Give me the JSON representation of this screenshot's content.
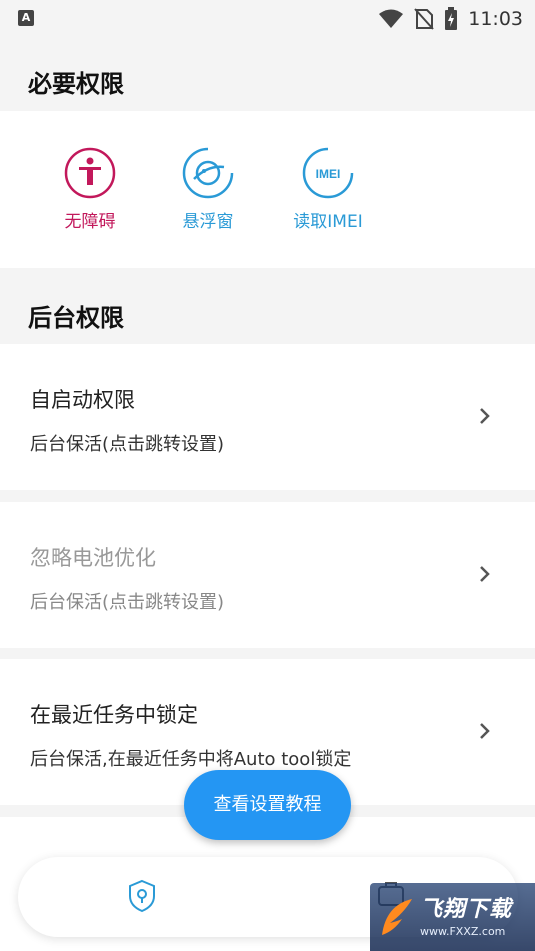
{
  "status_bar": {
    "left_icon_letter": "A",
    "time": "11:03",
    "icons": [
      "wifi-icon",
      "no-sim-icon",
      "battery-charging-icon"
    ]
  },
  "required_permissions": {
    "title": "必要权限",
    "items": [
      {
        "label": "无障碍",
        "icon": "accessibility-icon",
        "color": "#c2185b"
      },
      {
        "label": "悬浮窗",
        "icon": "floating-window-icon",
        "color": "#2a9ad6"
      },
      {
        "label": "读取IMEI",
        "icon": "imei-icon",
        "color": "#2a9ad6",
        "icon_text": "IMEI"
      }
    ]
  },
  "background_permissions": {
    "title": "后台权限",
    "rows": [
      {
        "title": "自启动权限",
        "subtitle": "后台保活(点击跳转设置)",
        "dimmed": false
      },
      {
        "title": "忽略电池优化",
        "subtitle": "后台保活(点击跳转设置)",
        "dimmed": true
      },
      {
        "title": "在最近任务中锁定",
        "subtitle": "后台保活,在最近任务中将Auto tool锁定",
        "dimmed": false
      }
    ]
  },
  "fab": {
    "label": "查看设置教程"
  },
  "bottom_nav": {
    "icons": [
      "location-shield-icon",
      "toolbox-icon"
    ]
  },
  "watermark": {
    "text": "飞翔下载",
    "url": "www.FXXZ.com"
  },
  "colors": {
    "accent": "#2496f3",
    "background": "#f4f4f4"
  }
}
